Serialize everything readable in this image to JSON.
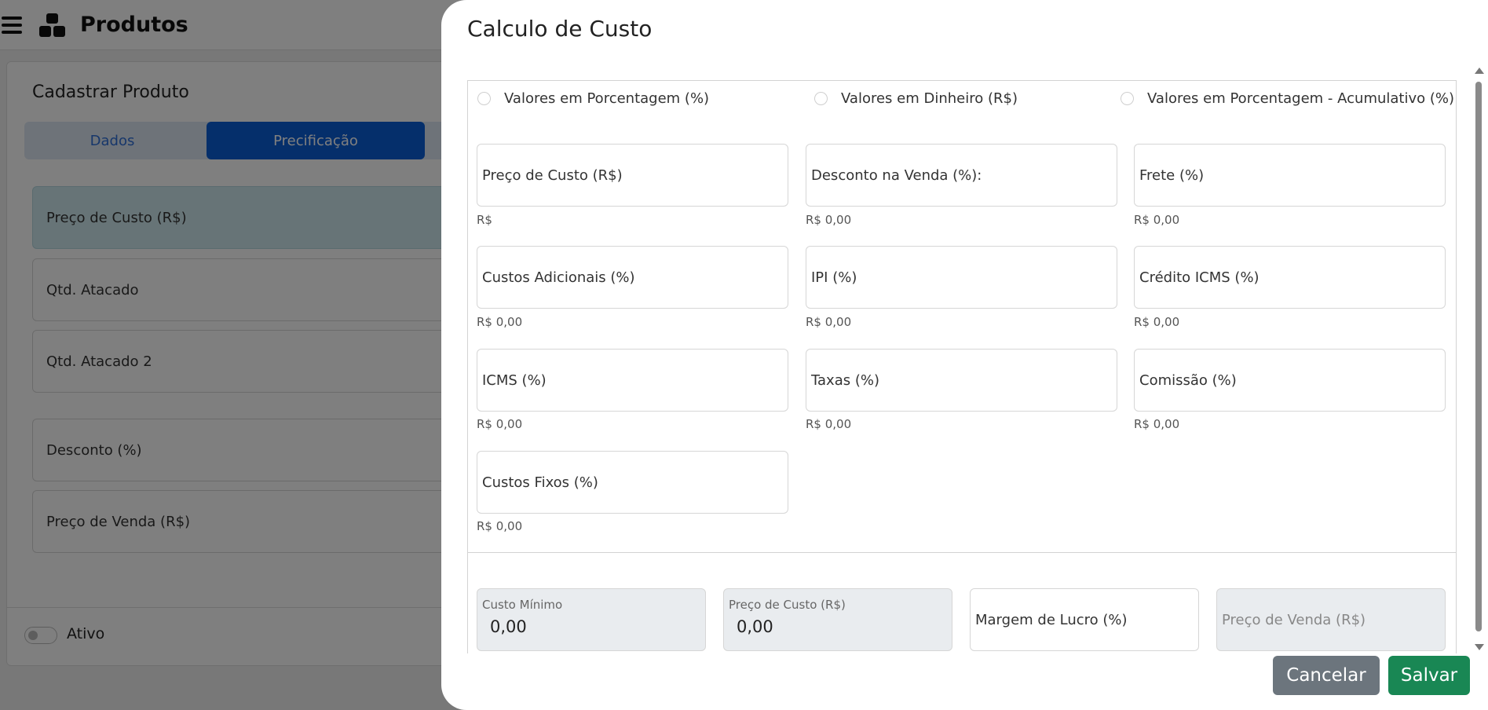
{
  "app": {
    "title": "Produtos"
  },
  "background": {
    "card_title": "Cadastrar Produto",
    "tabs": [
      {
        "label": "Dados",
        "active": false
      },
      {
        "label": "Precificação",
        "active": true
      }
    ],
    "fields": [
      {
        "label": "Preço de Custo (R$)",
        "highlighted": true
      },
      {
        "label": "Qtd. Atacado",
        "highlighted": false
      },
      {
        "label": "Qtd. Atacado 2",
        "highlighted": false
      },
      {
        "label": "Desconto (%)",
        "highlighted": false
      },
      {
        "label": "Preço de Venda (R$)",
        "highlighted": false
      }
    ],
    "active_toggle_label": "Ativo"
  },
  "modal": {
    "title": "Calculo de Custo",
    "radio_options": [
      {
        "label": "Valores em Porcentagem (%)",
        "checked": false
      },
      {
        "label": "Valores em Dinheiro (R$)",
        "checked": false
      },
      {
        "label": "Valores em Porcentagem - Acumulativo (%)",
        "checked": false
      }
    ],
    "fields": [
      {
        "label": "Preço de Custo (R$)",
        "hint": "R$"
      },
      {
        "label": "Desconto na Venda (%):",
        "hint": "R$ 0,00"
      },
      {
        "label": "Frete (%)",
        "hint": "R$ 0,00"
      },
      {
        "label": "Custos Adicionais (%)",
        "hint": "R$ 0,00"
      },
      {
        "label": "IPI (%)",
        "hint": "R$ 0,00"
      },
      {
        "label": "Crédito ICMS (%)",
        "hint": "R$ 0,00"
      },
      {
        "label": "ICMS (%)",
        "hint": "R$ 0,00"
      },
      {
        "label": "Taxas (%)",
        "hint": "R$ 0,00"
      },
      {
        "label": "Comissão (%)",
        "hint": "R$ 0,00"
      },
      {
        "label": "Custos Fixos (%)",
        "hint": "R$ 0,00"
      }
    ],
    "summary": {
      "custo_minimo": {
        "label": "Custo Mínimo",
        "value": "0,00"
      },
      "preco_custo": {
        "label": "Preço de Custo (R$)",
        "value": "0,00"
      },
      "margem_lucro": {
        "placeholder": "Margem de Lucro (%)"
      },
      "preco_venda": {
        "placeholder": "Preço de Venda (R$)"
      }
    },
    "buttons": {
      "cancel": "Cancelar",
      "save": "Salvar"
    }
  },
  "colors": {
    "primary": "#0b5ed7",
    "success": "#198754",
    "secondary": "#6c757d",
    "highlight_field": "#cfe8ee"
  }
}
